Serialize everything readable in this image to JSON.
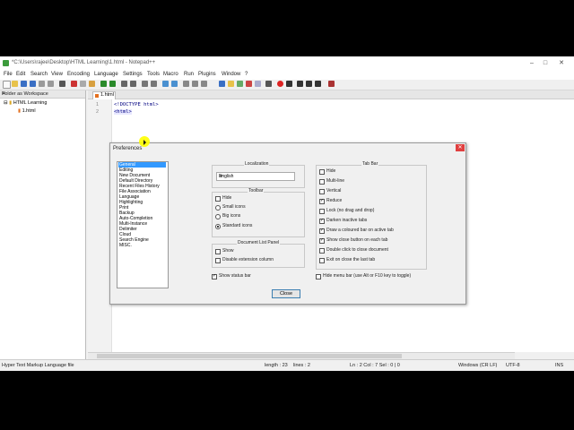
{
  "window": {
    "title": "*C:\\Users\\rajee\\Desktop\\HTML Learning\\1.html - Notepad++",
    "minimize": "–",
    "maximize": "□",
    "close": "✕"
  },
  "menu": [
    "File",
    "Edit",
    "Search",
    "View",
    "Encoding",
    "Language",
    "Settings",
    "Tools",
    "Macro",
    "Run",
    "Plugins",
    "Window",
    "?"
  ],
  "sidebar": {
    "title": "Folder as Workspace",
    "close": "✕",
    "folder": "HTML Learning",
    "file": "1.html"
  },
  "tab": {
    "label": "1.html"
  },
  "editor": {
    "lines": [
      {
        "n": "1",
        "code": "<!DOCTYPE html>"
      },
      {
        "n": "2",
        "code": "<html>"
      }
    ]
  },
  "status": {
    "filetype": "Hyper Text Markup Language file",
    "length": "length : 23",
    "lines": "lines : 2",
    "position": "Ln : 2   Col : 7   Sel : 0 | 0",
    "eol": "Windows (CR LF)",
    "encoding": "UTF-8",
    "mode": "INS"
  },
  "dialog": {
    "title": "Preferences",
    "close": "✕",
    "categories": [
      "General",
      "Editing",
      "New Document",
      "Default Directory",
      "Recent Files History",
      "File Association",
      "Language",
      "Highlighting",
      "Print",
      "Backup",
      "Auto-Completion",
      "Multi-Instance",
      "Delimiter",
      "Cloud",
      "Search Engine",
      "MISC."
    ],
    "selected_category": "General",
    "localization": {
      "title": "Localization",
      "value": "English"
    },
    "toolbar": {
      "title": "Toolbar",
      "hide": {
        "label": "Hide",
        "checked": false
      },
      "small": {
        "label": "Small icons",
        "checked": false
      },
      "big": {
        "label": "Big icons",
        "checked": false
      },
      "standard": {
        "label": "Standard icons",
        "checked": true
      }
    },
    "doclist": {
      "title": "Document List Panel",
      "show": {
        "label": "Show",
        "checked": false
      },
      "disable_ext": {
        "label": "Disable extension column",
        "checked": false
      }
    },
    "show_status_bar": {
      "label": "Show status bar",
      "checked": true
    },
    "tabbar": {
      "title": "Tab Bar",
      "items": [
        {
          "label": "Hide",
          "checked": false
        },
        {
          "label": "Multi-line",
          "checked": false
        },
        {
          "label": "Vertical",
          "checked": false
        },
        {
          "label": "Reduce",
          "checked": true
        },
        {
          "label": "Lock (no drag and drop)",
          "checked": false
        },
        {
          "label": "Darken inactive tabs",
          "checked": true
        },
        {
          "label": "Draw a coloured bar on active tab",
          "checked": true
        },
        {
          "label": "Show close button on each tab",
          "checked": true
        },
        {
          "label": "Double click to close document",
          "checked": false
        },
        {
          "label": "Exit on close the last tab",
          "checked": false
        }
      ]
    },
    "hide_menu_bar": {
      "label": "Hide menu bar (use Alt or F10 key to toggle)",
      "checked": false
    },
    "close_button": "Close"
  }
}
